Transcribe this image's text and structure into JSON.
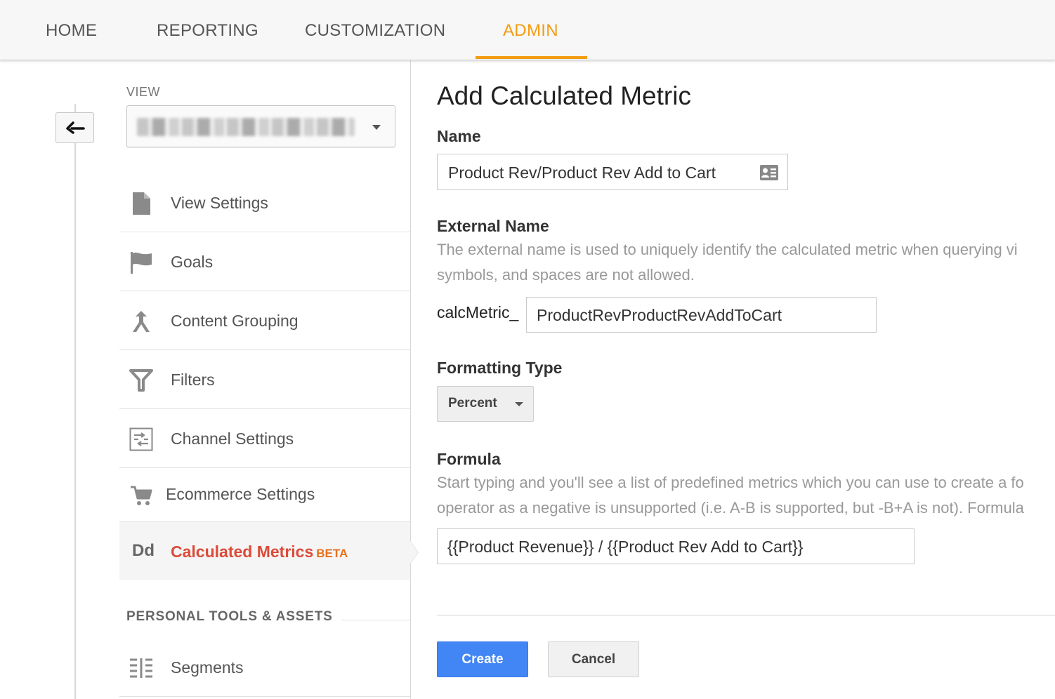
{
  "nav": {
    "tabs": [
      {
        "label": "HOME"
      },
      {
        "label": "REPORTING"
      },
      {
        "label": "CUSTOMIZATION"
      },
      {
        "label": "ADMIN"
      }
    ],
    "active_tab": "ADMIN",
    "accent_color": "#f39c12"
  },
  "sidebar": {
    "view_label": "VIEW",
    "items": [
      {
        "label": "View Settings",
        "icon": "document-icon"
      },
      {
        "label": "Goals",
        "icon": "flag-icon"
      },
      {
        "label": "Content Grouping",
        "icon": "grouping-icon"
      },
      {
        "label": "Filters",
        "icon": "filter-icon"
      },
      {
        "label": "Channel Settings",
        "icon": "channel-icon"
      },
      {
        "label": "Ecommerce Settings",
        "icon": "cart-icon"
      },
      {
        "label": "Calculated Metrics",
        "icon": "dd-icon",
        "icon_text": "Dd",
        "badge": "BETA",
        "selected": true
      }
    ],
    "section_title": "PERSONAL TOOLS & ASSETS",
    "personal_items": [
      {
        "label": "Segments",
        "icon": "segments-icon"
      }
    ],
    "selected_color": "#db4b39"
  },
  "form": {
    "title": "Add Calculated Metric",
    "name_label": "Name",
    "name_value": "Product Rev/Product Rev Add to Cart",
    "external_name_label": "External Name",
    "external_name_help_1": "The external name is used to uniquely identify the calculated metric when querying vi",
    "external_name_help_2": "symbols, and spaces are not allowed.",
    "external_name_prefix": "calcMetric_",
    "external_name_value": "ProductRevProductRevAddToCart",
    "formatting_type_label": "Formatting Type",
    "formatting_type_value": "Percent",
    "formula_label": "Formula",
    "formula_help_1": "Start typing and you'll see a list of predefined metrics which you can use to create a fo",
    "formula_help_2": "operator as a negative is unsupported (i.e. A-B is supported, but -B+A is not). Formula",
    "formula_value": "{{Product Revenue}} / {{Product Rev Add to Cart}}",
    "create_label": "Create",
    "cancel_label": "Cancel",
    "primary_color": "#4285f4"
  }
}
